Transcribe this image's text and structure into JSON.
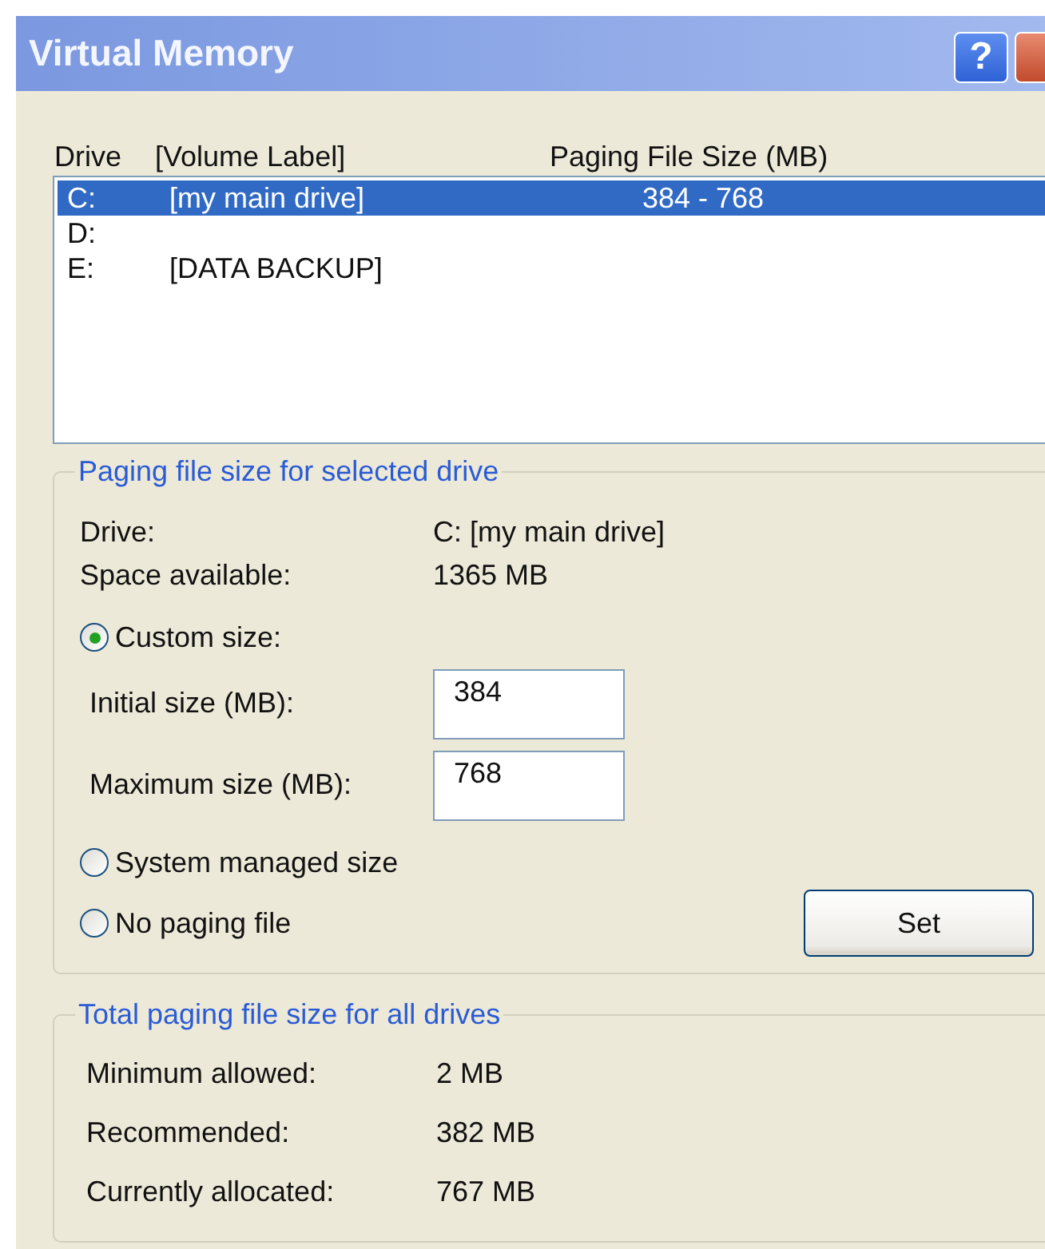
{
  "window": {
    "title": "Virtual Memory",
    "help_button": "?"
  },
  "drive_list": {
    "columns": [
      "Drive",
      "[Volume Label]",
      "Paging File Size (MB)"
    ],
    "rows": [
      {
        "drive": "C:",
        "label": "[my main drive]",
        "size": "384 - 768",
        "selected": true
      },
      {
        "drive": "D:",
        "selected": false
      },
      {
        "drive": "E:",
        "label": "[DATA BACKUP]",
        "selected": false
      }
    ]
  },
  "selected_drive": {
    "title": "Paging file size for selected drive",
    "info": [
      {
        "label": "Drive:",
        "value": "C:  [my main drive]"
      },
      {
        "label": "Space available:",
        "value": "1365 MB"
      }
    ],
    "options": [
      {
        "label": "Custom size:",
        "selected": true
      },
      {
        "label": "System managed size",
        "selected": false
      },
      {
        "label": "No paging file",
        "selected": false
      }
    ],
    "fields": [
      {
        "label": "Initial size (MB):",
        "value": "384"
      },
      {
        "label": "Maximum size (MB):",
        "value": "768"
      }
    ],
    "set_button": "Set"
  },
  "totals": {
    "title": "Total paging file size for all drives",
    "rows": [
      {
        "label": "Minimum allowed:",
        "value": "2 MB"
      },
      {
        "label": "Recommended:",
        "value": "382 MB"
      },
      {
        "label": "Currently allocated:",
        "value": "767 MB"
      }
    ]
  }
}
